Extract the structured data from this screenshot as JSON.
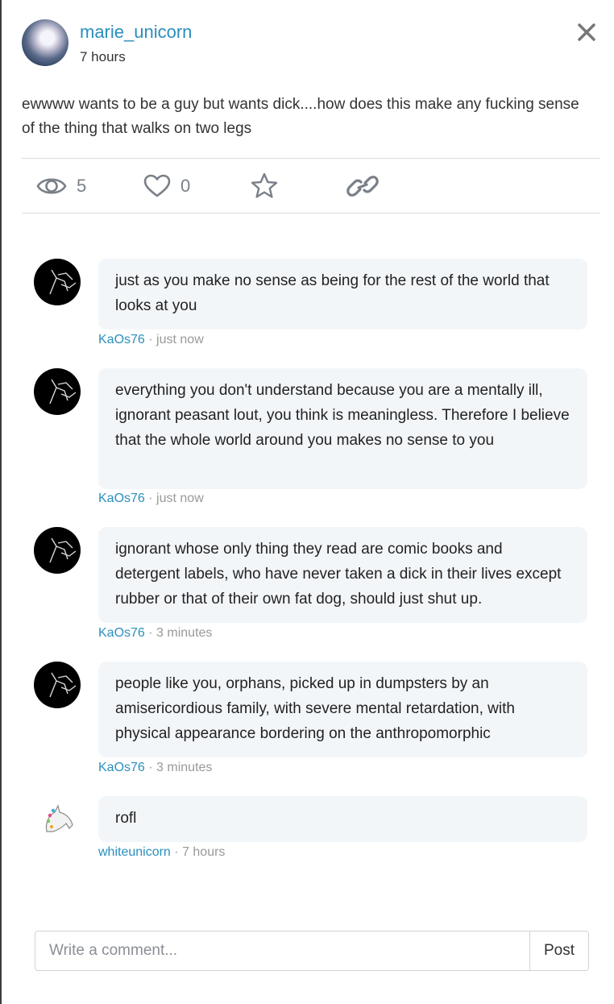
{
  "post": {
    "author": "marie_unicorn",
    "time": "7 hours",
    "text": "ewwww wants to be a guy but wants dick....how does this make any fucking sense of the thing that walks on two legs",
    "views": "5",
    "likes": "0"
  },
  "icons": {
    "close": "close-icon",
    "views": "eye-icon",
    "likes": "heart-icon",
    "favorite": "star-icon",
    "link": "link-icon"
  },
  "comments": [
    {
      "author": "KaOs76",
      "sep": "·",
      "time": "just now",
      "text": "just as you make no sense as being for the rest of the world that looks at you"
    },
    {
      "author": "KaOs76",
      "sep": "·",
      "time": "just now",
      "text": "everything you don't understand because you are a mentally ill, ignorant peasant lout, you think is meaningless. Therefore I believe that the whole world around you makes no sense to you"
    },
    {
      "author": "KaOs76",
      "sep": "·",
      "time": "3 minutes",
      "text": "ignorant whose only thing they read are comic books and detergent labels, who have never taken a dick in their lives except rubber or that of their own fat dog, should just shut up."
    },
    {
      "author": "KaOs76",
      "sep": "·",
      "time": "3 minutes",
      "text": "people like you, orphans, picked up in dumpsters by an amisericordious family, with severe mental retardation, with physical appearance bordering on the anthropomorphic"
    },
    {
      "author": "whiteunicorn",
      "sep": "·",
      "time": "7 hours",
      "text": "rofl"
    }
  ],
  "composer": {
    "placeholder": "Write a comment...",
    "post_label": "Post"
  },
  "colors": {
    "link": "#2a8fbd",
    "bubble": "#f3f6f9",
    "icon": "#7a8088"
  }
}
